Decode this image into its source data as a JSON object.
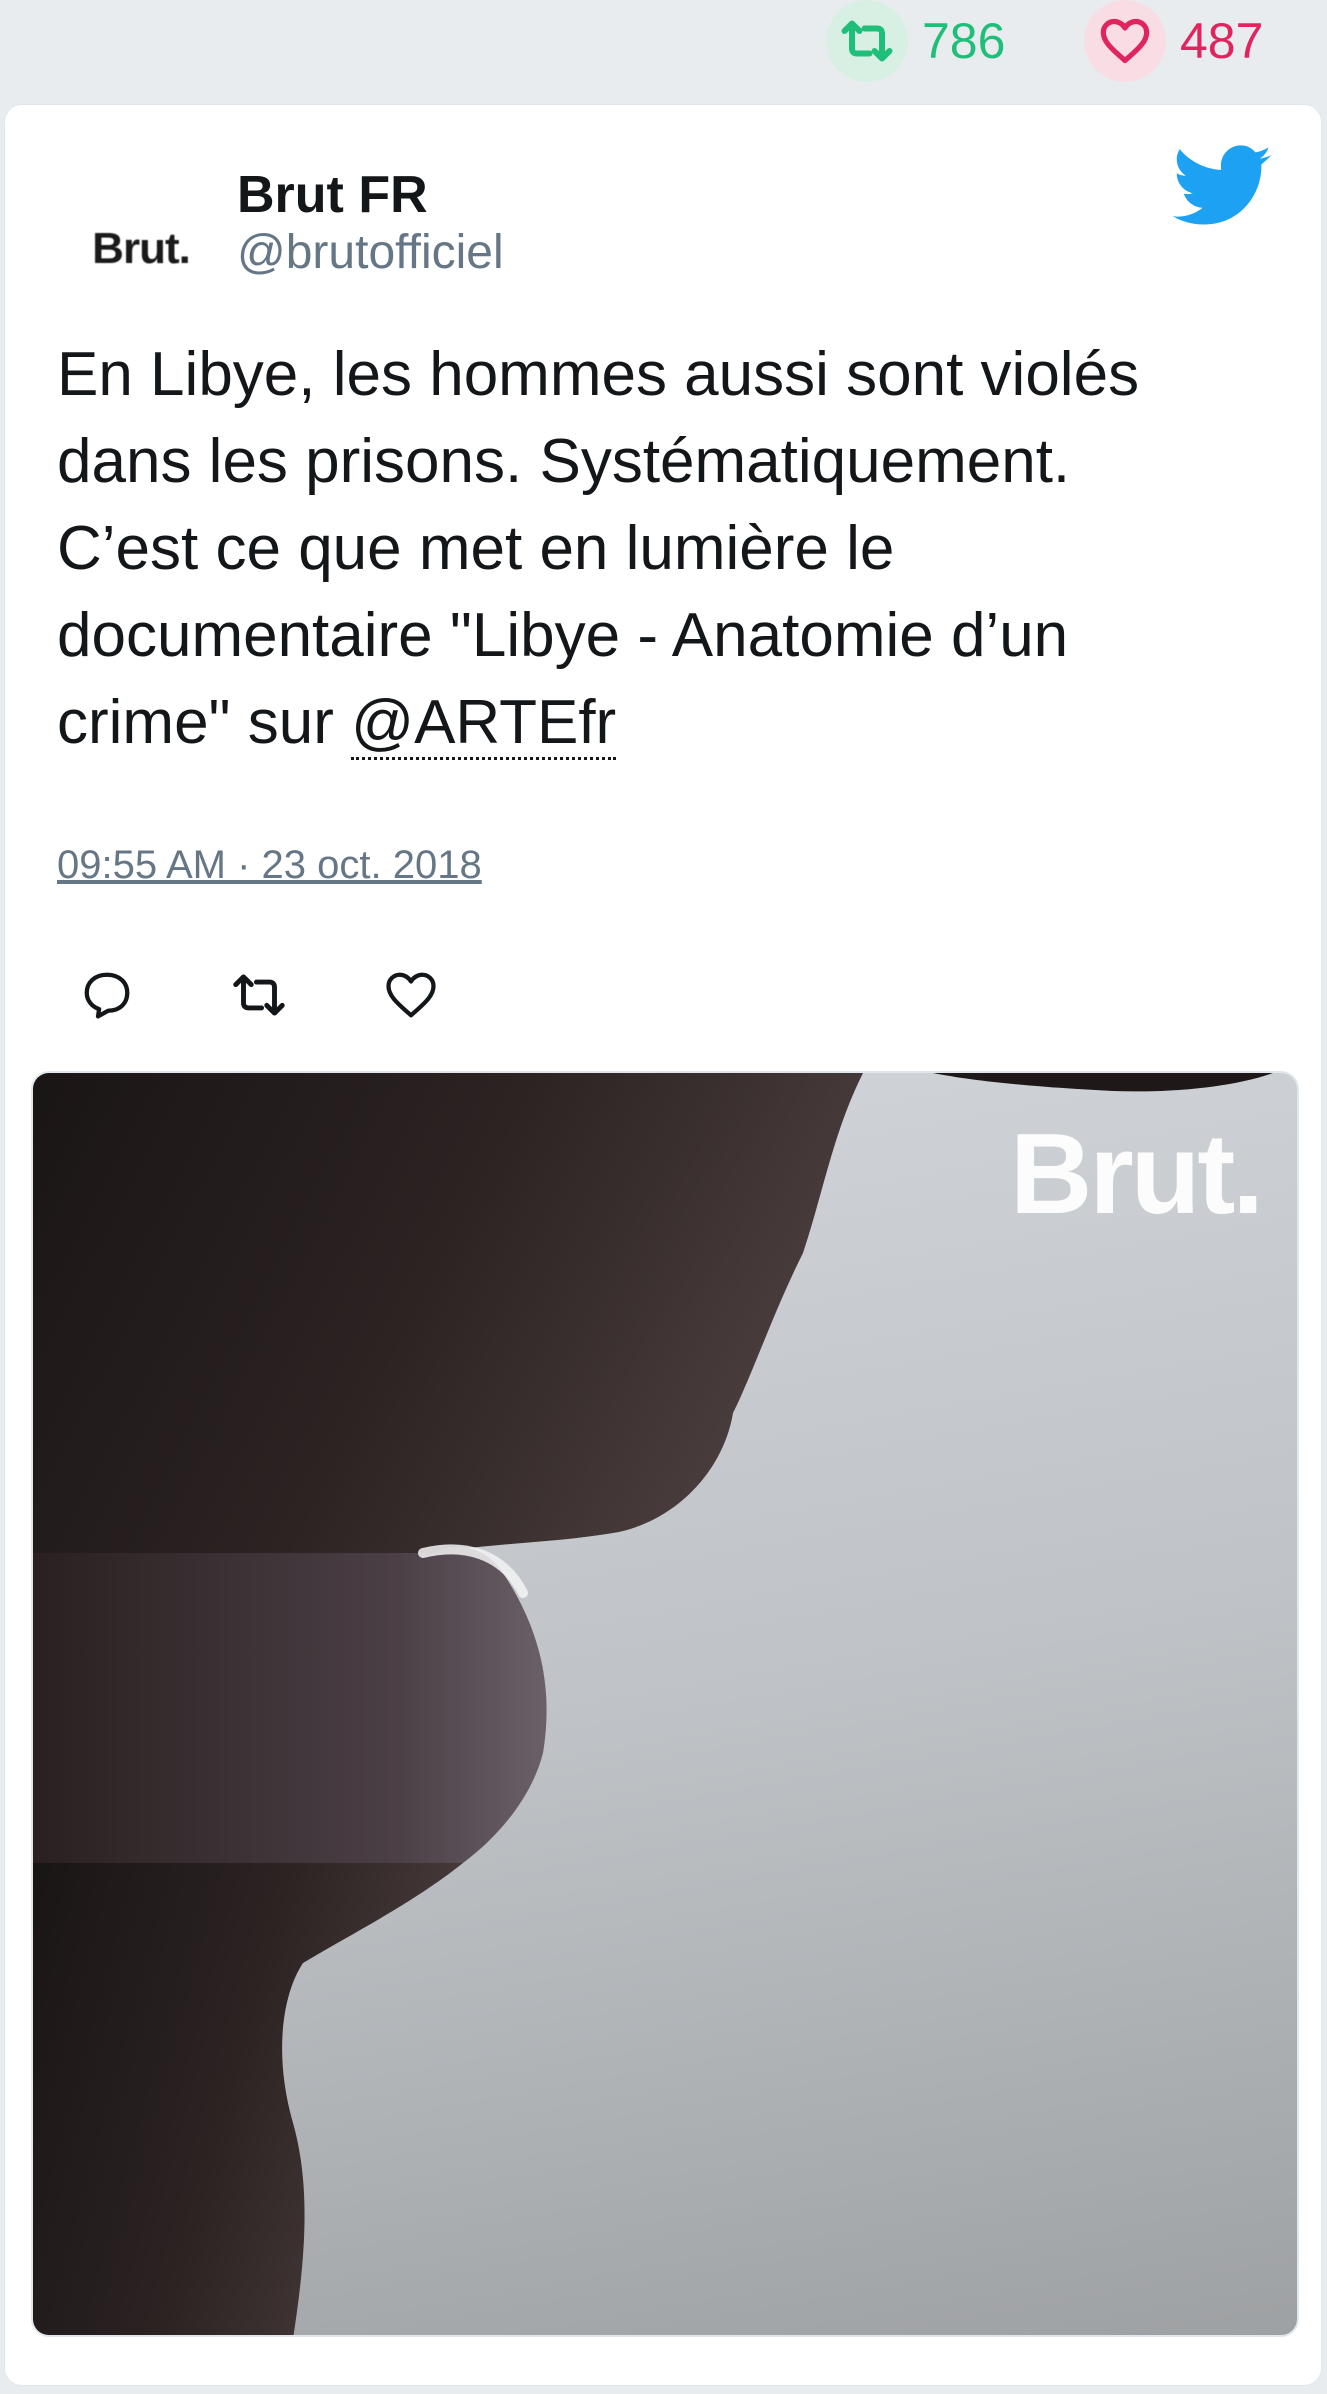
{
  "stats": {
    "retweets": "786",
    "likes": "487"
  },
  "tweet": {
    "author_name": "Brut FR",
    "author_handle": "@brutofficiel",
    "avatar_text": "Brut.",
    "text_line1": "En Libye, les hommes aussi sont violés",
    "text_line2": "dans les prisons. Systématiquement.",
    "text_line3": "C’est ce que met en lumière le",
    "text_line4": "documentaire \"Libye - Anatomie d’un",
    "text_line5_prefix": "crime\" sur ",
    "mention": "@ARTEfr",
    "timestamp": "09:55 AM · 23 oct. 2018"
  },
  "media": {
    "watermark": "Brut."
  },
  "icons": {
    "retweet_stat": "retweet-icon",
    "like_stat": "heart-icon",
    "logo": "twitter-bird-icon",
    "reply": "reply-icon",
    "retweet": "retweet-icon",
    "like": "heart-icon"
  },
  "colors": {
    "retweet": "#1fbf7a",
    "like": "#e0245e",
    "twitter_blue": "#1da1f2",
    "muted": "#657786"
  }
}
